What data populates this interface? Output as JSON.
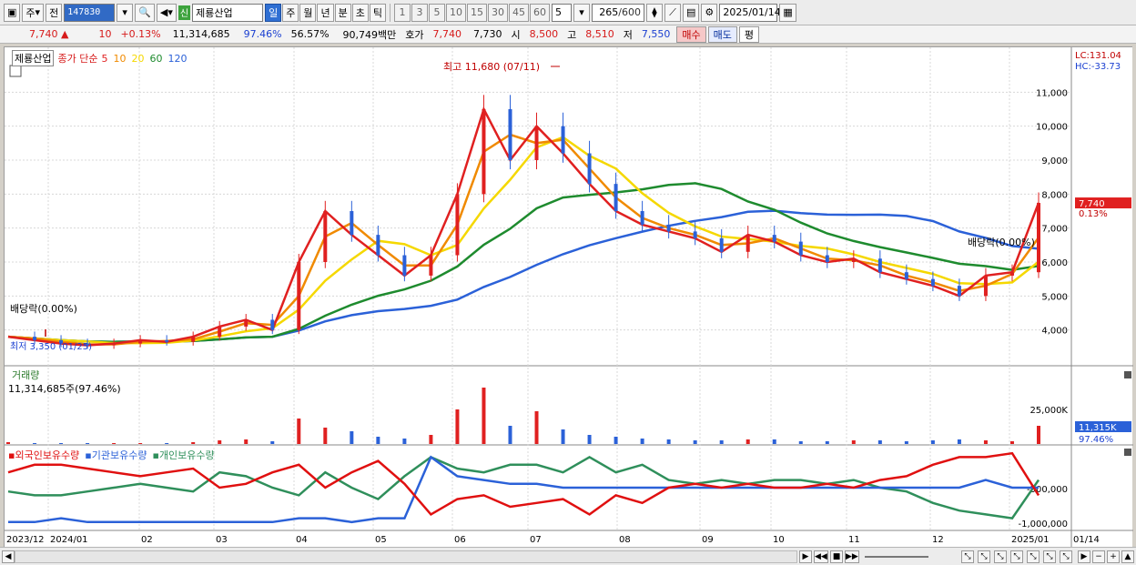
{
  "toolbar": {
    "period_main": "주",
    "period_prev": "전",
    "stock_code": "147830",
    "shin_badge": "신",
    "stock_name": "제룡산업",
    "timeframes": [
      "일",
      "주",
      "월",
      "년",
      "분",
      "초",
      "틱"
    ],
    "active_timeframe": "일",
    "numbers": [
      "1",
      "3",
      "5",
      "10",
      "15",
      "30",
      "45",
      "60"
    ],
    "interval": "5",
    "count": "265",
    "count_total": "/600",
    "date": "2025/01/14"
  },
  "quote": {
    "price": "7,740",
    "change": "10",
    "change_pct": "+0.13%",
    "volume": "11,314,685",
    "turnover_pct": "97.46%",
    "rate2": "56.57%",
    "amount": "90,749백만",
    "bid_label": "호가",
    "bid": "7,740",
    "ask": "7,730",
    "open_label": "시",
    "open": "8,500",
    "high_label": "고",
    "high": "8,510",
    "low_label": "저",
    "low": "7,550",
    "buy": "매수",
    "sell": "매도",
    "flat": "평"
  },
  "legend": {
    "name": "제룡산업",
    "label": "종가 단순",
    "ma": [
      "5",
      "10",
      "20",
      "60",
      "120"
    ],
    "ma_colors": [
      "#e02020",
      "#f08a00",
      "#f5d800",
      "#1e8b2e",
      "#2b61d8"
    ]
  },
  "right_info": {
    "lc": "LC:131.04",
    "hc": "HC:-33.73",
    "last_price": "7,740",
    "last_pct": "0.13%"
  },
  "annotations": {
    "high": "최고 11,680 (07/11)",
    "low": "최저 3,350 (01/25)",
    "div1": "배당락(0.00%)",
    "div2": "배당락(0.00%)"
  },
  "volume_panel": {
    "title": "거래량",
    "value": "11,314,685주(97.46%)",
    "last": "11,315K",
    "last_pct": "97.46%",
    "axis": [
      "25,000K"
    ]
  },
  "holdings_panel": {
    "items": [
      "외국인보유수량",
      "기관보유수량",
      "개인보유수량"
    ],
    "colors": [
      "#e01010",
      "#2b61d8",
      "#2f8f5b"
    ],
    "axis": [
      "-500,000",
      "-1,000,000"
    ]
  },
  "x_axis": [
    "2023/12",
    "2024/01",
    "02",
    "03",
    "04",
    "05",
    "06",
    "07",
    "08",
    "09",
    "10",
    "11",
    "12",
    "2025/01",
    "01/14"
  ],
  "chart_data": {
    "type": "line",
    "y_ticks": [
      4000,
      5000,
      6000,
      7000,
      8000,
      9000,
      10000,
      11000
    ],
    "ylim": [
      3000,
      12000
    ],
    "months": [
      "2023/12",
      "2024/01",
      "02",
      "03",
      "04",
      "05",
      "06",
      "07",
      "08",
      "09",
      "10",
      "11",
      "12",
      "2025/01"
    ],
    "close": [
      3800,
      3700,
      3600,
      3550,
      3600,
      3700,
      3650,
      3800,
      4100,
      4300,
      4000,
      6000,
      7500,
      6800,
      6200,
      5600,
      6200,
      8000,
      10500,
      9000,
      10000,
      9200,
      8300,
      7500,
      7100,
      6900,
      6700,
      6300,
      6800,
      6600,
      6200,
      6000,
      6100,
      5700,
      5500,
      5300,
      5000,
      5600,
      5700,
      7740
    ],
    "series": [
      {
        "name": "5",
        "color": "#e02020"
      },
      {
        "name": "10",
        "color": "#f08a00"
      },
      {
        "name": "20",
        "color": "#f5d800"
      },
      {
        "name": "60",
        "color": "#1e8b2e"
      },
      {
        "name": "120",
        "color": "#2b61d8"
      }
    ]
  }
}
